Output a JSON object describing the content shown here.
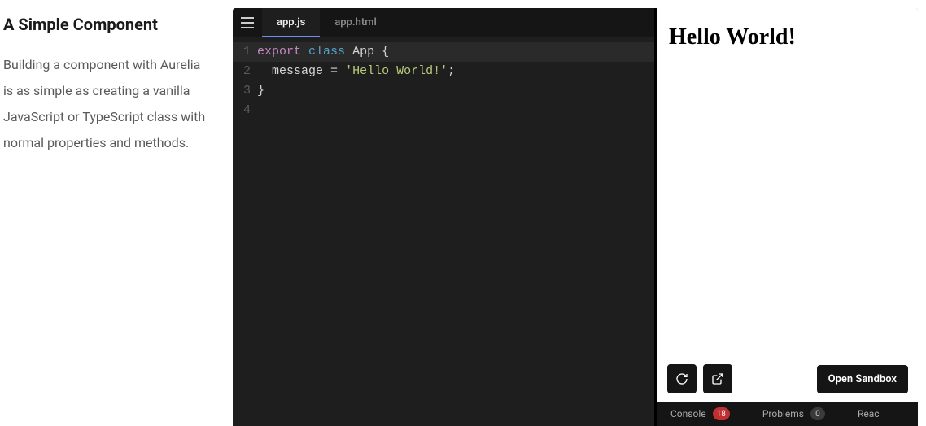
{
  "left": {
    "heading": "A Simple Component",
    "paragraph": "Building a component with Aurelia is as simple as creating a vanilla JavaScript or TypeScript class with normal properties and methods."
  },
  "editor": {
    "tabs": [
      {
        "label": "app.js",
        "active": true
      },
      {
        "label": "app.html",
        "active": false
      }
    ],
    "code": {
      "lines": [
        {
          "n": "1",
          "tokens": [
            [
              "kw",
              "export"
            ],
            [
              "sp",
              " "
            ],
            [
              "kw2",
              "class"
            ],
            [
              "sp",
              " "
            ],
            [
              "type",
              "App"
            ],
            [
              "sp",
              " "
            ],
            [
              "op",
              "{"
            ]
          ]
        },
        {
          "n": "2",
          "tokens": [
            [
              "sp",
              "  "
            ],
            [
              "prop",
              "message"
            ],
            [
              "sp",
              " "
            ],
            [
              "op",
              "="
            ],
            [
              "sp",
              " "
            ],
            [
              "str",
              "'Hello World!'"
            ],
            [
              "op",
              ";"
            ]
          ]
        },
        {
          "n": "3",
          "tokens": [
            [
              "op",
              "}"
            ]
          ]
        },
        {
          "n": "4",
          "tokens": []
        }
      ]
    }
  },
  "preview": {
    "heading": "Hello World!",
    "open_label": "Open Sandbox"
  },
  "bottom": {
    "console": {
      "label": "Console",
      "count": "18"
    },
    "problems": {
      "label": "Problems",
      "count": "0"
    },
    "react": {
      "label": "Reac"
    }
  }
}
